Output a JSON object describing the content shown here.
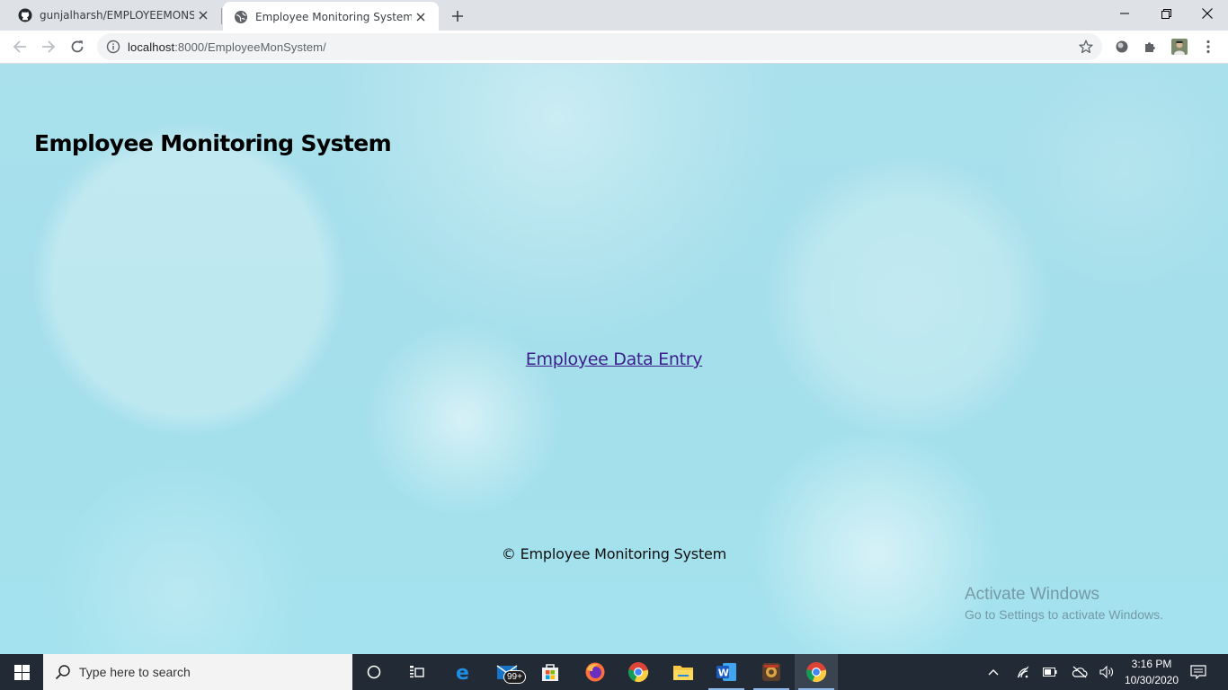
{
  "browser": {
    "tabs": [
      {
        "title": "gunjalharsh/EMPLOYEEMONSYST",
        "active": false,
        "favicon": "github-icon"
      },
      {
        "title": "Employee Monitoring System",
        "active": true,
        "favicon": "globe-icon"
      }
    ],
    "url": {
      "host": "localhost",
      "rest": ":8000/EmployeeMonSystem/"
    }
  },
  "page": {
    "title": "Employee Monitoring System",
    "link_label": "Employee Data Entry",
    "footer": "© Employee Monitoring System",
    "background_color": "#a6e0ec",
    "link_color": "#3c1f8c"
  },
  "watermark": {
    "line1": "Activate Windows",
    "line2": "Go to Settings to activate Windows."
  },
  "taskbar": {
    "search_placeholder": "Type here to search",
    "mail_badge": "99+",
    "time": "3:16 PM",
    "date": "10/30/2020",
    "apps": [
      "cortana-icon",
      "task-view-icon",
      "edge-icon",
      "mail-icon",
      "store-icon",
      "firefox-icon",
      "chrome-icon",
      "file-explorer-icon",
      "word-icon",
      "app-icon",
      "chrome-icon"
    ]
  }
}
